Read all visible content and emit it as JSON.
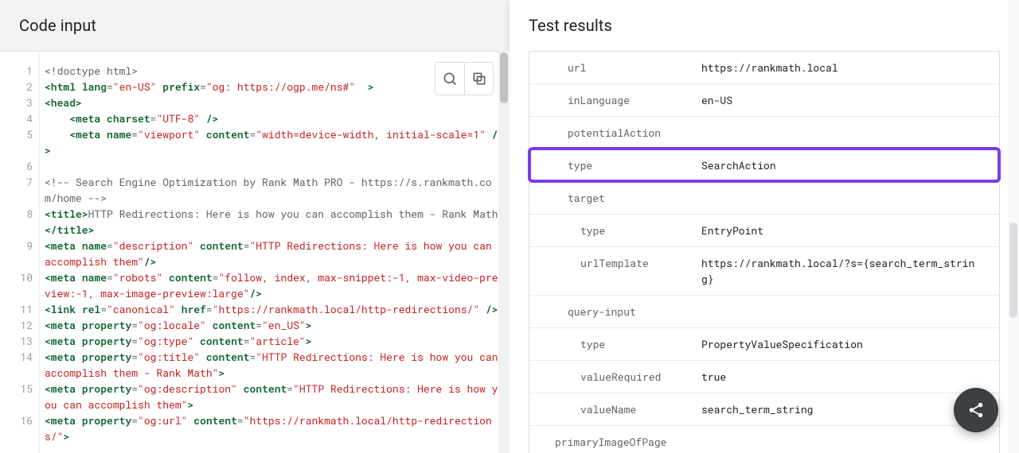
{
  "left": {
    "title": "Code input",
    "code": [
      {
        "n": "1",
        "segs": [
          [
            "comment",
            "<!doctype html>"
          ]
        ]
      },
      {
        "n": "2",
        "segs": [
          [
            "tag",
            "<html "
          ],
          [
            "attr",
            "lang"
          ],
          [
            "punct",
            "="
          ],
          [
            "str",
            "\"en-US\""
          ],
          [
            "punct",
            " "
          ],
          [
            "attr",
            "prefix"
          ],
          [
            "punct",
            "="
          ],
          [
            "str",
            "\"og: https://ogp.me/ns#\""
          ],
          [
            "punct",
            " "
          ],
          [
            "tag",
            " >"
          ]
        ]
      },
      {
        "n": "3",
        "segs": [
          [
            "tag",
            "<head>"
          ]
        ]
      },
      {
        "n": "4",
        "segs": [
          [
            "punct",
            "    "
          ],
          [
            "tag",
            "<meta "
          ],
          [
            "attr",
            "charset"
          ],
          [
            "punct",
            "="
          ],
          [
            "str",
            "\"UTF-8\""
          ],
          [
            "punct",
            " "
          ],
          [
            "tag",
            "/>"
          ]
        ]
      },
      {
        "n": "5",
        "segs": [
          [
            "punct",
            "    "
          ],
          [
            "tag",
            "<meta "
          ],
          [
            "attr",
            "name"
          ],
          [
            "punct",
            "="
          ],
          [
            "str",
            "\"viewport\""
          ],
          [
            "punct",
            " "
          ],
          [
            "attr",
            "content"
          ],
          [
            "punct",
            "="
          ],
          [
            "str",
            "\"width=device-width, initial-scale=1\""
          ],
          [
            "punct",
            " "
          ],
          [
            "tag",
            "/>"
          ]
        ]
      },
      {
        "n": "6",
        "segs": []
      },
      {
        "n": "7",
        "segs": [
          [
            "comment",
            "<!-- Search Engine Optimization by Rank Math PRO - https://s.rankmath.com/home -->"
          ]
        ]
      },
      {
        "n": "8",
        "segs": [
          [
            "tag",
            "<title>"
          ],
          [
            "punct",
            "HTTP Redirections: Here is how you can accomplish them - Rank Math"
          ],
          [
            "tag",
            "</title>"
          ]
        ]
      },
      {
        "n": "9",
        "segs": [
          [
            "tag",
            "<meta "
          ],
          [
            "attr",
            "name"
          ],
          [
            "punct",
            "="
          ],
          [
            "str",
            "\"description\""
          ],
          [
            "punct",
            " "
          ],
          [
            "attr",
            "content"
          ],
          [
            "punct",
            "="
          ],
          [
            "str",
            "\"HTTP Redirections: Here is how you can accomplish them\""
          ],
          [
            "tag",
            "/>"
          ]
        ]
      },
      {
        "n": "10",
        "segs": [
          [
            "tag",
            "<meta "
          ],
          [
            "attr",
            "name"
          ],
          [
            "punct",
            "="
          ],
          [
            "str",
            "\"robots\""
          ],
          [
            "punct",
            " "
          ],
          [
            "attr",
            "content"
          ],
          [
            "punct",
            "="
          ],
          [
            "str",
            "\"follow, index, max-snippet:-1, max-video-preview:-1, max-image-preview:large\""
          ],
          [
            "tag",
            "/>"
          ]
        ]
      },
      {
        "n": "11",
        "segs": [
          [
            "tag",
            "<link "
          ],
          [
            "attr",
            "rel"
          ],
          [
            "punct",
            "="
          ],
          [
            "str",
            "\"canonical\""
          ],
          [
            "punct",
            " "
          ],
          [
            "attr",
            "href"
          ],
          [
            "punct",
            "="
          ],
          [
            "str",
            "\"https://rankmath.local/http-redirections/\""
          ],
          [
            "punct",
            " "
          ],
          [
            "tag",
            "/>"
          ]
        ]
      },
      {
        "n": "12",
        "segs": [
          [
            "tag",
            "<meta "
          ],
          [
            "attr",
            "property"
          ],
          [
            "punct",
            "="
          ],
          [
            "str",
            "\"og:locale\""
          ],
          [
            "punct",
            " "
          ],
          [
            "attr",
            "content"
          ],
          [
            "punct",
            "="
          ],
          [
            "str",
            "\"en_US\""
          ],
          [
            "tag",
            ">"
          ]
        ]
      },
      {
        "n": "13",
        "segs": [
          [
            "tag",
            "<meta "
          ],
          [
            "attr",
            "property"
          ],
          [
            "punct",
            "="
          ],
          [
            "str",
            "\"og:type\""
          ],
          [
            "punct",
            " "
          ],
          [
            "attr",
            "content"
          ],
          [
            "punct",
            "="
          ],
          [
            "str",
            "\"article\""
          ],
          [
            "tag",
            ">"
          ]
        ]
      },
      {
        "n": "14",
        "segs": [
          [
            "tag",
            "<meta "
          ],
          [
            "attr",
            "property"
          ],
          [
            "punct",
            "="
          ],
          [
            "str",
            "\"og:title\""
          ],
          [
            "punct",
            " "
          ],
          [
            "attr",
            "content"
          ],
          [
            "punct",
            "="
          ],
          [
            "str",
            "\"HTTP Redirections: Here is how you can accomplish them - Rank Math\""
          ],
          [
            "tag",
            ">"
          ]
        ]
      },
      {
        "n": "15",
        "segs": [
          [
            "tag",
            "<meta "
          ],
          [
            "attr",
            "property"
          ],
          [
            "punct",
            "="
          ],
          [
            "str",
            "\"og:description\""
          ],
          [
            "punct",
            " "
          ],
          [
            "attr",
            "content"
          ],
          [
            "punct",
            "="
          ],
          [
            "str",
            "\"HTTP Redirections: Here is how you can accomplish them\""
          ],
          [
            "tag",
            ">"
          ]
        ]
      },
      {
        "n": "16",
        "segs": [
          [
            "tag",
            "<meta "
          ],
          [
            "attr",
            "property"
          ],
          [
            "punct",
            "="
          ],
          [
            "str",
            "\"og:url\""
          ],
          [
            "punct",
            " "
          ],
          [
            "attr",
            "content"
          ],
          [
            "punct",
            "="
          ],
          [
            "str",
            "\"https://rankmath.local/http-redirections/\""
          ],
          [
            "tag",
            ">"
          ]
        ]
      }
    ]
  },
  "right": {
    "title": "Test results",
    "rows": [
      {
        "indent": 2,
        "key": "url",
        "val": "https://rankmath.local",
        "hl": false
      },
      {
        "indent": 2,
        "key": "inLanguage",
        "val": "en-US",
        "hl": false
      },
      {
        "indent": 2,
        "key": "potentialAction",
        "val": "",
        "hl": false
      },
      {
        "indent": 2,
        "key": "type",
        "val": "SearchAction",
        "hl": true
      },
      {
        "indent": 2,
        "key": "target",
        "val": "",
        "hl": false
      },
      {
        "indent": 3,
        "key": "type",
        "val": "EntryPoint",
        "hl": false
      },
      {
        "indent": 3,
        "key": "urlTemplate",
        "val": "https://rankmath.local/?s={search_term_string}",
        "hl": false
      },
      {
        "indent": 2,
        "key": "query-input",
        "val": "",
        "hl": false
      },
      {
        "indent": 3,
        "key": "type",
        "val": "PropertyValueSpecification",
        "hl": false
      },
      {
        "indent": 3,
        "key": "valueRequired",
        "val": "true",
        "hl": false
      },
      {
        "indent": 3,
        "key": "valueName",
        "val": "search_term_string",
        "hl": false
      },
      {
        "indent": 1,
        "key": "primaryImageOfPage",
        "val": "",
        "hl": false
      }
    ]
  }
}
